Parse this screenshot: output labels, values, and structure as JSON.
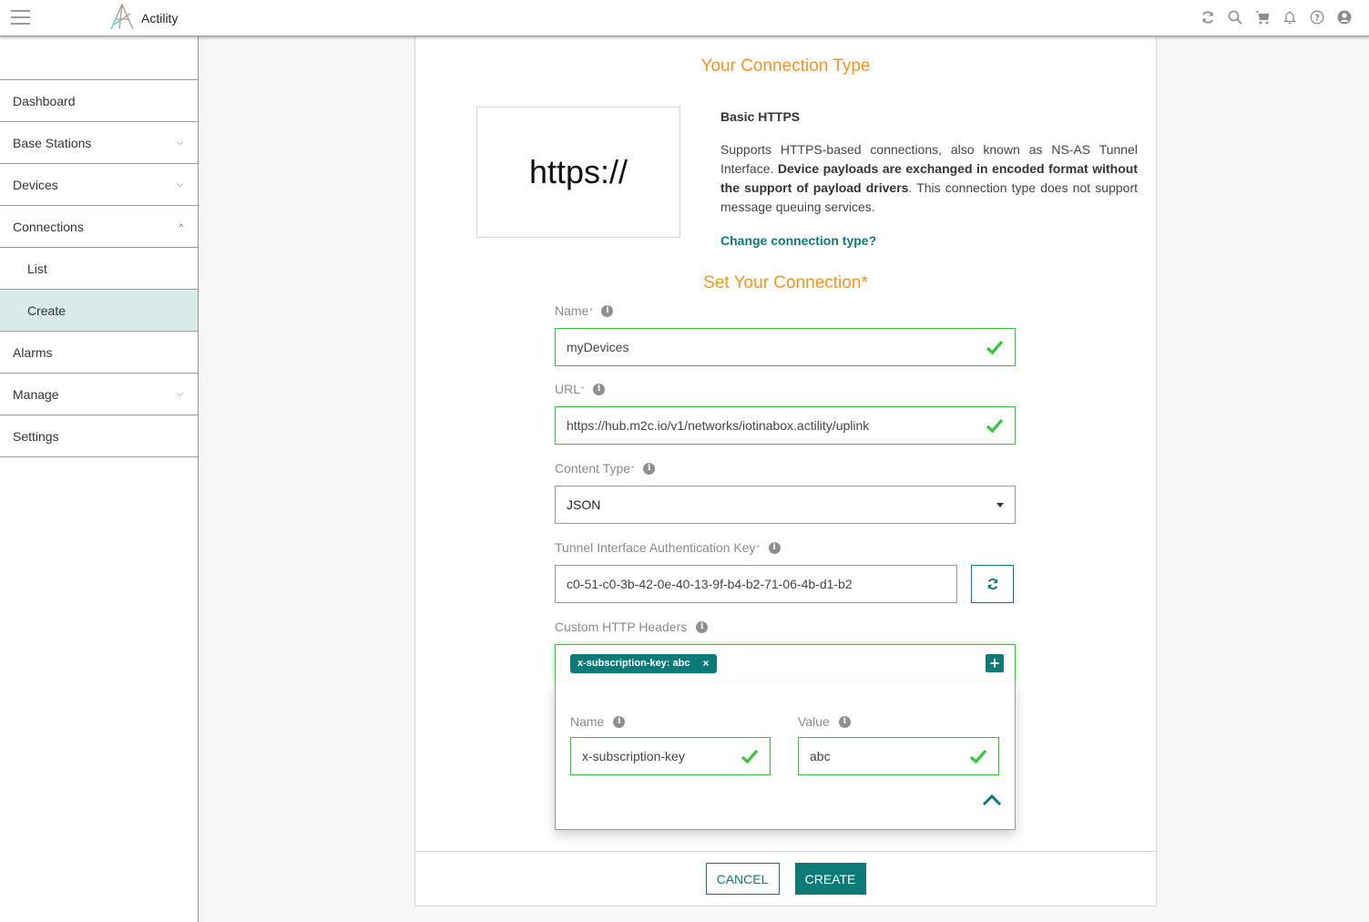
{
  "app": {
    "brand": "Actility",
    "accent_color": "#0c7b78",
    "heading_color": "#f7941d",
    "valid_color": "#2dc937"
  },
  "topbar": {
    "icons": [
      "refresh-icon",
      "search-icon",
      "cart-icon",
      "bell-icon",
      "help-icon",
      "user-icon"
    ]
  },
  "sidebar": {
    "items": [
      {
        "label": "Dashboard"
      },
      {
        "label": "Base Stations",
        "chevron": "⌄"
      },
      {
        "label": "Devices",
        "chevron": "⌄"
      },
      {
        "label": "Connections",
        "chevron": "^"
      },
      {
        "label": "List"
      },
      {
        "label": "Create",
        "active": true
      },
      {
        "label": "Alarms"
      },
      {
        "label": "Manage",
        "chevron": "⌄"
      },
      {
        "label": "Settings"
      }
    ]
  },
  "connection_type": {
    "heading": "Your Connection Type",
    "image_text": "https://",
    "name": "Basic HTTPS",
    "desc_1": "Supports HTTPS-based connections, also known as NS-AS Tunnel Interface. ",
    "desc_bold": "Device payloads are exchanged in encoded format without the support of payload drivers",
    "desc_2": ". This connection type does not support message queuing services.",
    "change_link": "Change connection type?"
  },
  "form": {
    "heading": "Set Your Connection*",
    "name": {
      "label": "Name",
      "required": "*",
      "value": "myDevices"
    },
    "url": {
      "label": "URL",
      "required": "*",
      "value": "https://hub.m2c.io/v1/networks/iotinabox.actility/uplink"
    },
    "content_type": {
      "label": "Content Type",
      "required": "*",
      "value": "JSON"
    },
    "auth_key": {
      "label": "Tunnel Interface Authentication Key",
      "required": "*",
      "value": "c0-51-c0-3b-42-0e-40-13-9f-b4-b2-71-06-4b-d1-b2"
    },
    "custom_headers": {
      "label": "Custom HTTP Headers",
      "chips": [
        {
          "text": "x-subscription-key: abc",
          "remove": "×"
        }
      ],
      "add_symbol": "+",
      "editor": {
        "name_label": "Name",
        "name_value": "x-subscription-key",
        "value_label": "Value",
        "value_value": "abc"
      }
    }
  },
  "footer": {
    "cancel": "CANCEL",
    "create": "CREATE"
  }
}
